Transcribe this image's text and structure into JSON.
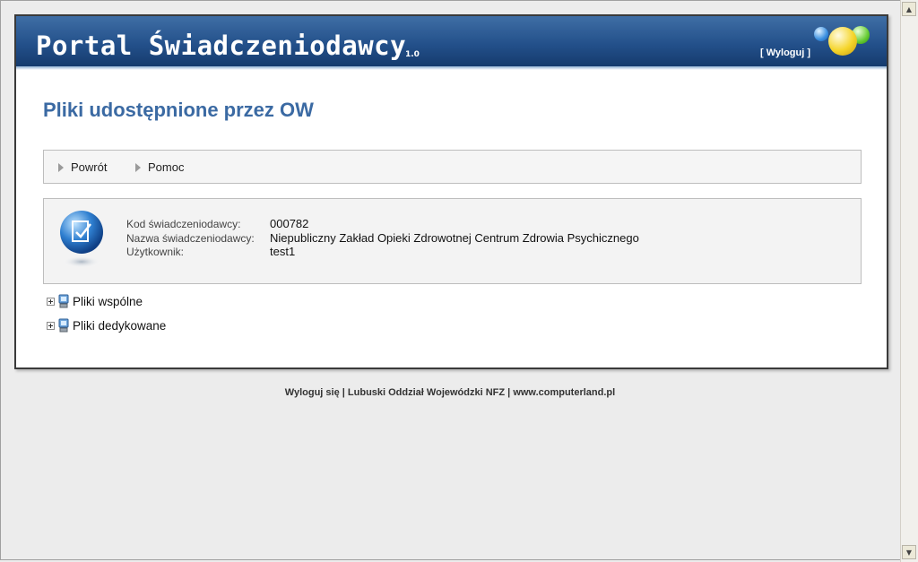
{
  "header": {
    "title": "Portal Świadczeniodawcy",
    "version": "1.0",
    "logout_label": "[ Wyloguj ]"
  },
  "page": {
    "title": "Pliki udostępnione przez OW"
  },
  "toolbar": {
    "back_label": "Powrót",
    "help_label": "Pomoc"
  },
  "info": {
    "provider_code_label": "Kod świadczeniodawcy:",
    "provider_code_value": "000782",
    "provider_name_label": "Nazwa świadczeniodawcy:",
    "provider_name_value": "Niepubliczny Zakład Opieki Zdrowotnej Centrum Zdrowia Psychicznego",
    "user_label": "Użytkownik:",
    "user_value": "test1"
  },
  "tree": {
    "items": [
      {
        "label": "Pliki wspólne",
        "icon": "computer-icon"
      },
      {
        "label": "Pliki dedykowane",
        "icon": "computer-icon"
      }
    ]
  },
  "footer": {
    "logout_label": "Wyloguj się",
    "separator": " | ",
    "org_label": "Lubuski Oddział Wojewódzki NFZ",
    "website_label": "www.computerland.pl"
  },
  "colors": {
    "header_blue": "#23508a",
    "title_blue": "#3b6aa3"
  }
}
